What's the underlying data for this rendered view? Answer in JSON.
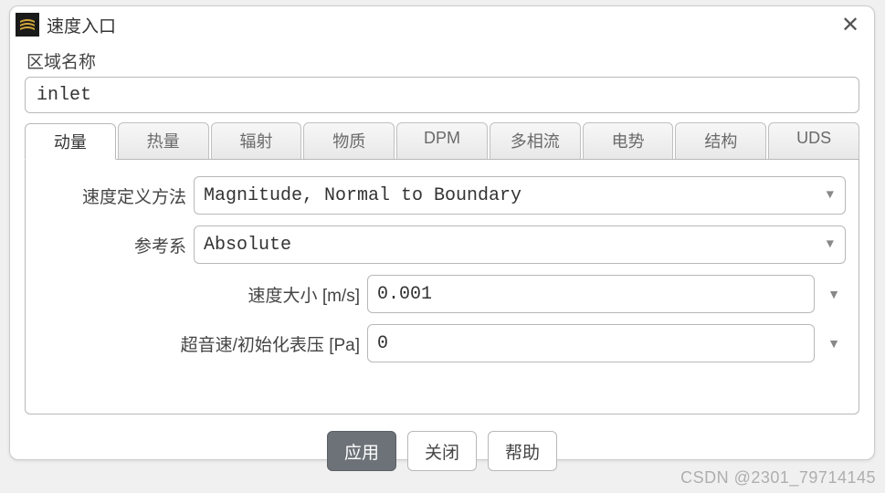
{
  "dialog": {
    "title": "速度入口",
    "close_icon": "✕"
  },
  "zone": {
    "label": "区域名称",
    "value": "inlet"
  },
  "tabs": [
    {
      "label": "动量",
      "active": true
    },
    {
      "label": "热量",
      "active": false
    },
    {
      "label": "辐射",
      "active": false
    },
    {
      "label": "物质",
      "active": false
    },
    {
      "label": "DPM",
      "active": false
    },
    {
      "label": "多相流",
      "active": false
    },
    {
      "label": "电势",
      "active": false
    },
    {
      "label": "结构",
      "active": false
    },
    {
      "label": "UDS",
      "active": false
    }
  ],
  "form": {
    "velocity_method": {
      "label": "速度定义方法",
      "value": "Magnitude, Normal to Boundary"
    },
    "reference_frame": {
      "label": "参考系",
      "value": "Absolute"
    },
    "velocity_magnitude": {
      "label": "速度大小 [m/s]",
      "value": "0.001"
    },
    "supersonic_pressure": {
      "label": "超音速/初始化表压 [Pa]",
      "value": "0"
    }
  },
  "buttons": {
    "apply": "应用",
    "close": "关闭",
    "help": "帮助"
  },
  "watermark": "CSDN @2301_79714145"
}
